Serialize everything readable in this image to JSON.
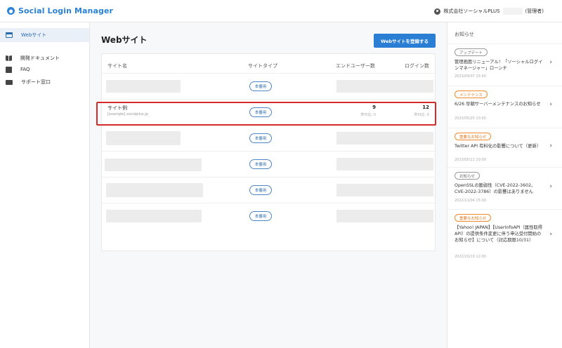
{
  "header": {
    "app_name": "Social Login Manager",
    "account_name": "株式会社ソーシャルPLUS",
    "account_role": "(管理者)"
  },
  "sidebar": {
    "items": [
      {
        "label": "Webサイト",
        "icon": "website-icon"
      },
      {
        "label": "開発ドキュメント",
        "icon": "book-icon"
      },
      {
        "label": "FAQ",
        "icon": "faq-icon"
      },
      {
        "label": "サポート窓口",
        "icon": "mail-icon"
      }
    ]
  },
  "main": {
    "title": "Webサイト",
    "register_button": "Webサイトを登録する",
    "columns": [
      "サイト名",
      "サイトタイプ",
      "エンドユーザー数",
      "ログイン数"
    ],
    "badge_label": "本番用",
    "example_site": {
      "name": "サイト例",
      "url": "[example] socialplus.jp",
      "end_users": "9",
      "end_users_sub": "昨日比: 0",
      "logins": "12",
      "logins_sub": "昨日比: 0"
    }
  },
  "notices": {
    "title": "お知らせ",
    "items": [
      {
        "tag": "アップデート",
        "tag_style": "gray",
        "text": "管理画面リニューアル！「ソーシャルログインマネージャー」ローンチ",
        "date": "2023/09/07 15:00"
      },
      {
        "tag": "メンテナンス",
        "tag_style": "orange",
        "text": "6/26 早朝サーバーメンテナンスのお知らせ",
        "date": "2023/05/25 10:00"
      },
      {
        "tag": "重要なお知らせ",
        "tag_style": "orange",
        "text": "Twitter API 有料化の影響について（更新）",
        "date": "2023/05/11 10:00"
      },
      {
        "tag": "お知らせ",
        "tag_style": "gray",
        "text": "OpenSSLの脆弱性（CVE-2022-3602、CVE-2022-3786）の影響はありません",
        "date": "2022/11/04 15:00"
      },
      {
        "tag": "重要なお知らせ",
        "tag_style": "orange",
        "text": "【Yahoo! JAPAN】【UserInfoAPI（属性取得API）の提供条件変更に伴う申込受付開始のお知らせ】について（対応期限10/31）",
        "date": "2022/10/19 12:00"
      }
    ]
  },
  "colors": {
    "accent": "#2a7fd4",
    "highlight": "#d42a2a",
    "tag_orange": "#f08a2c"
  }
}
